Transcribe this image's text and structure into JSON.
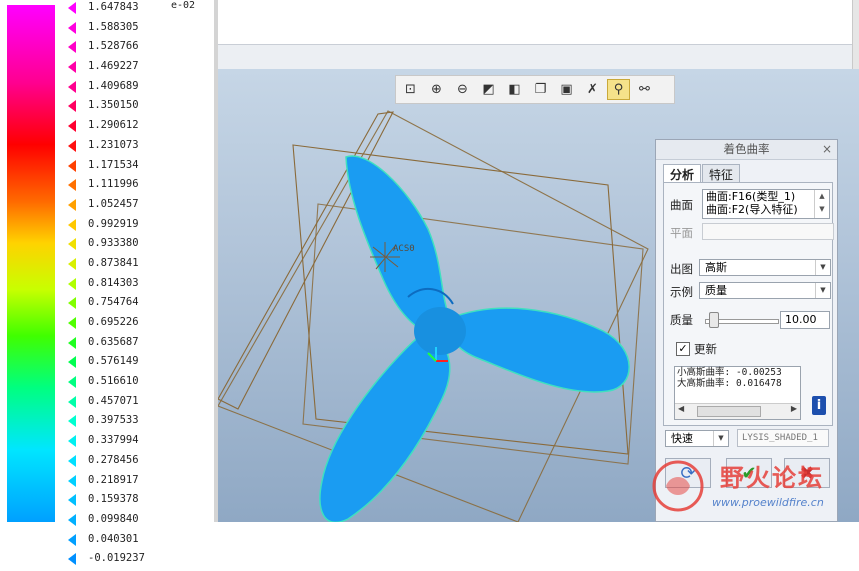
{
  "legend": {
    "exponent": "e-02",
    "rows": [
      {
        "value": "1.647843",
        "color": "#ff00ff"
      },
      {
        "value": "1.588305",
        "color": "#ff00e0"
      },
      {
        "value": "1.528766",
        "color": "#ff00c8"
      },
      {
        "value": "1.469227",
        "color": "#ff00a8"
      },
      {
        "value": "1.409689",
        "color": "#ff0090"
      },
      {
        "value": "1.350150",
        "color": "#ff0060"
      },
      {
        "value": "1.290612",
        "color": "#ff0030"
      },
      {
        "value": "1.231073",
        "color": "#ff1010"
      },
      {
        "value": "1.171534",
        "color": "#ff4000"
      },
      {
        "value": "1.111996",
        "color": "#ff7000"
      },
      {
        "value": "1.052457",
        "color": "#ffa000"
      },
      {
        "value": "0.992919",
        "color": "#ffc800"
      },
      {
        "value": "0.933380",
        "color": "#f0e000"
      },
      {
        "value": "0.873841",
        "color": "#d8f000"
      },
      {
        "value": "0.814303",
        "color": "#b0ff00"
      },
      {
        "value": "0.754764",
        "color": "#80ff00"
      },
      {
        "value": "0.695226",
        "color": "#50ff00"
      },
      {
        "value": "0.635687",
        "color": "#20ff20"
      },
      {
        "value": "0.576149",
        "color": "#00ff50"
      },
      {
        "value": "0.516610",
        "color": "#00ff80"
      },
      {
        "value": "0.457071",
        "color": "#00ffa8"
      },
      {
        "value": "0.397533",
        "color": "#00ffd0"
      },
      {
        "value": "0.337994",
        "color": "#00f0f0"
      },
      {
        "value": "0.278456",
        "color": "#00e0ff"
      },
      {
        "value": "0.218917",
        "color": "#00d0ff"
      },
      {
        "value": "0.159378",
        "color": "#00c0ff"
      },
      {
        "value": "0.099840",
        "color": "#00b0ff"
      },
      {
        "value": "0.040301",
        "color": "#00a0ff"
      },
      {
        "value": "-0.019237",
        "color": "#0090ff"
      }
    ]
  },
  "toolbar": {
    "buttons": [
      {
        "name": "refit-icon",
        "glyph": "⊡"
      },
      {
        "name": "zoom-in-icon",
        "glyph": "⊕"
      },
      {
        "name": "zoom-out-icon",
        "glyph": "⊖"
      },
      {
        "name": "repaint-icon",
        "glyph": "◩"
      },
      {
        "name": "display-style-icon",
        "glyph": "◧"
      },
      {
        "name": "saved-views-icon",
        "glyph": "❐"
      },
      {
        "name": "view-manager-icon",
        "glyph": "▣"
      },
      {
        "name": "datum-display-icon",
        "glyph": "✗"
      },
      {
        "name": "spin-center-icon",
        "glyph": "⚲",
        "active": true
      },
      {
        "name": "annotation-display-icon",
        "glyph": "⚯"
      }
    ]
  },
  "scene": {
    "csys_label": "ACS0",
    "surface_color": "#1a9cf2",
    "edge_color": "#30e8a0",
    "datum_plane_color": "#8a6a3a"
  },
  "dialog": {
    "title": "着色曲率",
    "close": "×",
    "tabs": [
      {
        "label": "分析",
        "active": true
      },
      {
        "label": "特征",
        "active": false
      }
    ],
    "surface_label": "曲面",
    "surface_items": [
      "曲面:F16(类型_1)",
      "曲面:F2(导入特征)"
    ],
    "plane_label": "平面",
    "output_label": "出图",
    "output_value": "高斯",
    "example_label": "示例",
    "example_value": "质量",
    "quality_label": "质量",
    "quality_value": "10.00",
    "quality_fraction": 0.05,
    "update_label": "更新",
    "update_checked": "✓",
    "readout_lines": [
      "小高斯曲率: -0.00253",
      "大高斯曲率: 0.016478"
    ],
    "info_glyph": "i",
    "mode_value": "快速",
    "status_text": "LYSIS_SHADED_1",
    "repeat_glyph": "⟳",
    "ok_glyph": "✔",
    "cancel_glyph": "✖"
  },
  "watermark": {
    "title": "野火论坛",
    "url": "www.proewildfire.cn"
  }
}
